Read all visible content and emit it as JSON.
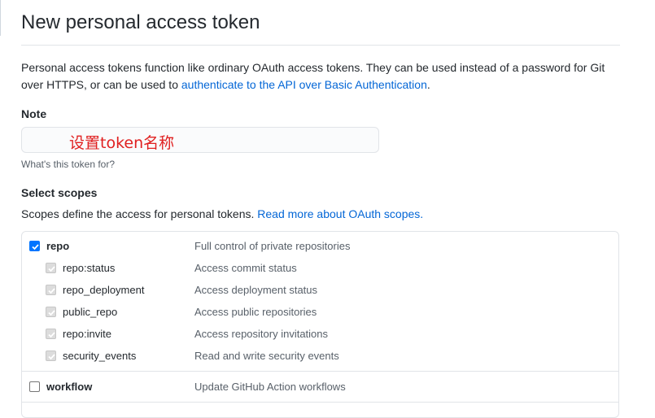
{
  "page": {
    "title": "New personal access token",
    "intro_text": "Personal access tokens function like ordinary OAuth access tokens. They can be used instead of a password for Git over HTTPS, or can be used to ",
    "intro_link": "authenticate to the API over Basic Authentication",
    "intro_end": "."
  },
  "note": {
    "label": "Note",
    "value": "",
    "annotation": "设置token名称",
    "hint": "What's this token for?"
  },
  "scopes": {
    "label": "Select scopes",
    "desc_text": "Scopes define the access for personal tokens. ",
    "desc_link": "Read more about OAuth scopes.",
    "items": [
      {
        "name": "repo",
        "desc": "Full control of private repositories",
        "checked": true,
        "sub": false
      },
      {
        "name": "repo:status",
        "desc": "Access commit status",
        "checked": true,
        "sub": true
      },
      {
        "name": "repo_deployment",
        "desc": "Access deployment status",
        "checked": true,
        "sub": true
      },
      {
        "name": "public_repo",
        "desc": "Access public repositories",
        "checked": true,
        "sub": true
      },
      {
        "name": "repo:invite",
        "desc": "Access repository invitations",
        "checked": true,
        "sub": true
      },
      {
        "name": "security_events",
        "desc": "Read and write security events",
        "checked": true,
        "sub": true
      },
      {
        "name": "workflow",
        "desc": "Update GitHub Action workflows",
        "checked": false,
        "sub": false
      }
    ]
  },
  "colors": {
    "link": "#0366d6",
    "annotation": "#e02020",
    "checkbox_checked": "#0075ff"
  }
}
